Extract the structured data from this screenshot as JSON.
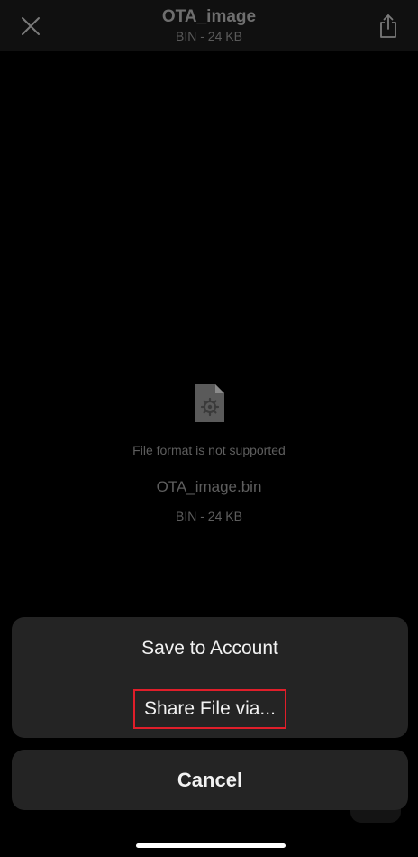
{
  "header": {
    "title": "OTA_image",
    "subtitle": "BIN - 24 KB",
    "close_icon": "close-icon",
    "share_icon": "share-icon"
  },
  "preview": {
    "file_icon": "file-gear-icon",
    "message": "File format is not supported",
    "file_name": "OTA_image.bin",
    "file_size": "BIN - 24 KB"
  },
  "action_sheet": {
    "save_label": "Save to Account",
    "share_label": "Share File via...",
    "cancel_label": "Cancel",
    "highlight_color": "#e01e2a"
  },
  "colors": {
    "background": "#000000",
    "sheet": "#242424",
    "header": "#101010"
  }
}
